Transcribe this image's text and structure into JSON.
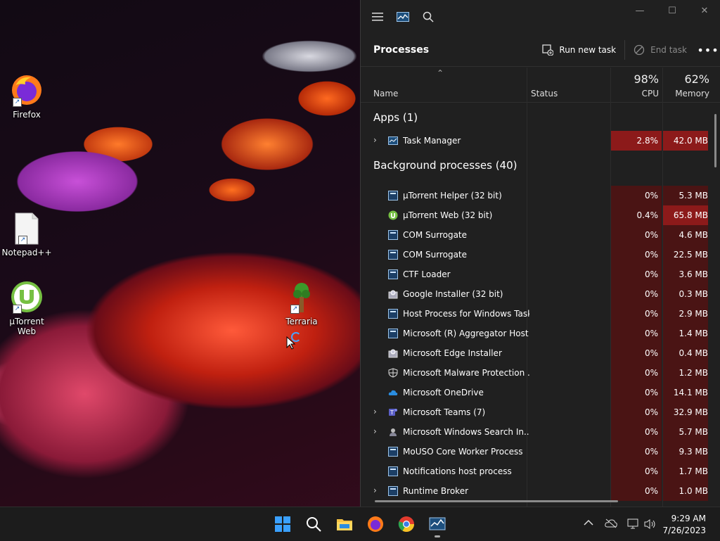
{
  "desktop": {
    "icons": [
      {
        "label": "Firefox"
      },
      {
        "label": "Notepad++"
      },
      {
        "label": "µTorrent Web"
      },
      {
        "label": "Terraria"
      }
    ]
  },
  "taskmgr": {
    "cmd": {
      "title": "Processes",
      "run_new_task": "Run new task",
      "end_task": "End task"
    },
    "columns": {
      "name": "Name",
      "status": "Status",
      "cpu_pct": "98%",
      "cpu": "CPU",
      "mem_pct": "62%",
      "mem": "Memory"
    },
    "groups": {
      "apps": "Apps (1)",
      "background": "Background processes (40)"
    },
    "apps": [
      {
        "name": "Task Manager",
        "cpu": "2.8%",
        "mem": "42.0 MB",
        "icon": "task-manager-icon"
      }
    ],
    "background": [
      {
        "name": "µTorrent Helper (32 bit)",
        "cpu": "0%",
        "mem": "5.3 MB",
        "icon": "window-icon"
      },
      {
        "name": "µTorrent Web (32 bit)",
        "cpu": "0.4%",
        "mem": "65.8 MB",
        "icon": "utorrent-icon"
      },
      {
        "name": "COM Surrogate",
        "cpu": "0%",
        "mem": "4.6 MB",
        "icon": "window-icon"
      },
      {
        "name": "COM Surrogate",
        "cpu": "0%",
        "mem": "22.5 MB",
        "icon": "window-icon"
      },
      {
        "name": "CTF Loader",
        "cpu": "0%",
        "mem": "3.6 MB",
        "icon": "window-icon"
      },
      {
        "name": "Google Installer (32 bit)",
        "cpu": "0%",
        "mem": "0.3 MB",
        "icon": "installer-icon"
      },
      {
        "name": "Host Process for Windows Tasks",
        "cpu": "0%",
        "mem": "2.9 MB",
        "icon": "window-icon"
      },
      {
        "name": "Microsoft (R) Aggregator Host",
        "cpu": "0%",
        "mem": "1.4 MB",
        "icon": "window-icon"
      },
      {
        "name": "Microsoft Edge Installer",
        "cpu": "0%",
        "mem": "0.4 MB",
        "icon": "installer-icon"
      },
      {
        "name": "Microsoft Malware Protection ...",
        "cpu": "0%",
        "mem": "1.2 MB",
        "icon": "shield-icon"
      },
      {
        "name": "Microsoft OneDrive",
        "cpu": "0%",
        "mem": "14.1 MB",
        "icon": "onedrive-icon"
      },
      {
        "name": "Microsoft Teams (7)",
        "cpu": "0%",
        "mem": "32.9 MB",
        "icon": "teams-icon"
      },
      {
        "name": "Microsoft Windows Search In...",
        "cpu": "0%",
        "mem": "5.7 MB",
        "icon": "search-indexer-icon"
      },
      {
        "name": "MoUSO Core Worker Process",
        "cpu": "0%",
        "mem": "9.3 MB",
        "icon": "window-icon"
      },
      {
        "name": "Notifications host process",
        "cpu": "0%",
        "mem": "1.7 MB",
        "icon": "window-icon"
      },
      {
        "name": "Runtime Broker",
        "cpu": "0%",
        "mem": "1.0 MB",
        "icon": "window-icon"
      }
    ]
  },
  "taskbar": {
    "time": "9:29 AM",
    "date": "7/26/2023"
  }
}
